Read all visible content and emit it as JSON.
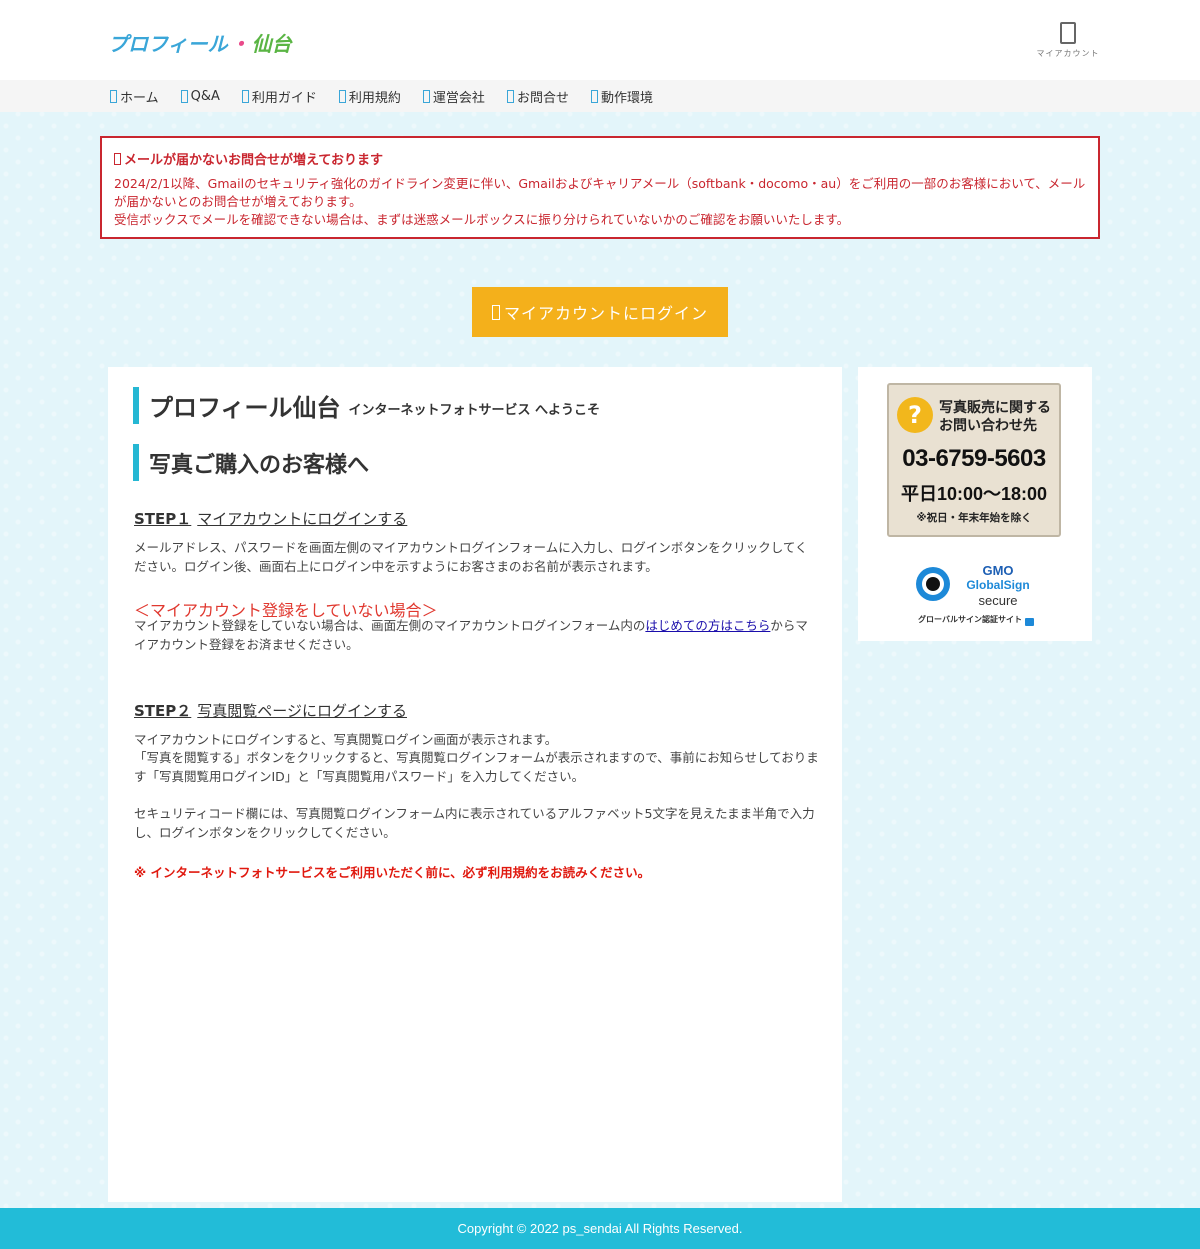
{
  "header": {
    "logo_part1": "プロフィール",
    "logo_dot": "・",
    "logo_part2": "仙台",
    "account_label": "マイアカウント",
    "account_icon": "user-icon"
  },
  "nav": {
    "items": [
      {
        "label": "ホーム",
        "icon": "home-icon"
      },
      {
        "label": "Q&A",
        "icon": "question-icon"
      },
      {
        "label": "利用ガイド",
        "icon": "guide-icon"
      },
      {
        "label": "利用規約",
        "icon": "terms-icon"
      },
      {
        "label": "運営会社",
        "icon": "company-icon"
      },
      {
        "label": "お問合せ",
        "icon": "mail-icon"
      },
      {
        "label": "動作環境",
        "icon": "environment-icon"
      }
    ]
  },
  "notice": {
    "title": "メールが届かないお問合せが増えております",
    "line1": "2024/2/1以降、Gmailのセキュリティ強化のガイドライン変更に伴い、Gmailおよびキャリアメール（softbank・docomo・au）をご利用の一部のお客様において、メールが届かないとのお問合せが増えております。",
    "line2": "受信ボックスでメールを確認できない場合は、まずは迷惑メールボックスに振り分けられていないかのご確認をお願いいたします。"
  },
  "login_button": "マイアカウントにログイン",
  "main": {
    "welcome_big": "プロフィール仙台",
    "welcome_small": "インターネットフォトサービス へようこそ",
    "buy_heading": "写真ご購入のお客様へ",
    "step1_label": "STEP１",
    "step1_title": "マイアカウントにログインする",
    "step1_text": "メールアドレス、パスワードを画面左側のマイアカウントログインフォームに入力し、ログインボタンをクリックしてください。ログイン後、画面右上にログイン中を示すようにお客さまのお名前が表示されます。",
    "not_registered_heading": "＜マイアカウント登録をしていない場合＞",
    "not_registered_text_before": "マイアカウント登録をしていない場合は、画面左側のマイアカウントログインフォーム内の",
    "not_registered_link": "はじめての方はこちら",
    "not_registered_text_after": "からマイアカウント登録をお済ませください。",
    "step2_label": "STEP２",
    "step2_title": "写真閲覧ページにログインする",
    "step2_text1": "マイアカウントにログインすると、写真閲覧ログイン画面が表示されます。",
    "step2_text2": "「写真を閲覧する」ボタンをクリックすると、写真閲覧ログインフォームが表示されますので、事前にお知らせしております「写真閲覧用ログインID」と「写真閲覧用パスワード」を入力してください。",
    "step2_text3": "セキュリティコード欄には、写真閲覧ログインフォーム内に表示されているアルファベット5文字を見えたまま半角で入力し、ログインボタンをクリックしてください。",
    "warning": "※ インターネットフォトサービスをご利用いただく前に、必ず利用規約をお読みください。"
  },
  "sidebar": {
    "contact_head1": "写真販売に関する",
    "contact_head2": "お問い合わせ先",
    "contact_q": "?",
    "tel": "03-6759-5603",
    "hours": "平日10:00〜18:00",
    "note": "※祝日・年末年始を除く",
    "seal_gmo": "GMO",
    "seal_gs": "GlobalSign",
    "seal_secure": "secure",
    "seal_caption": "グローバルサイン認証サイト"
  },
  "footer": {
    "copyright": "Copyright © 2022 ps_sendai All Rights Reserved."
  }
}
